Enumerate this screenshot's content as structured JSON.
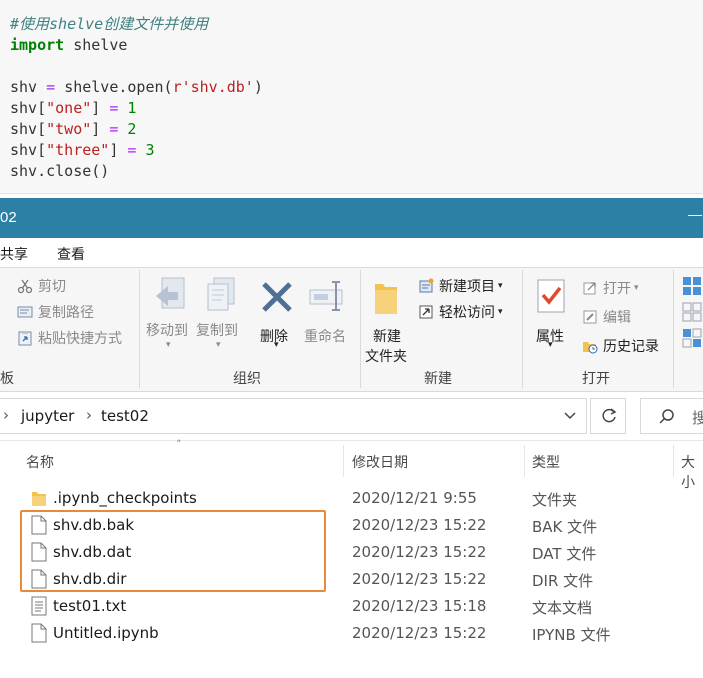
{
  "code": {
    "comment": "#使用shelve创建文件并使用",
    "import_kw": "import",
    "import_mod": " shelve",
    "line_open_a": "shv",
    "line_open_b": " = ",
    "line_open_c": "shelve.open(",
    "line_open_d": "r'shv.db'",
    "line_open_e": ")",
    "assign1_a": "shv[",
    "assign1_key": "\"one\"",
    "assign1_b": "] ",
    "assign1_eq": "=",
    "assign1_val": " 1",
    "assign2_a": "shv[",
    "assign2_key": "\"two\"",
    "assign2_b": "] ",
    "assign2_eq": "=",
    "assign2_val": " 2",
    "assign3_a": "shv[",
    "assign3_key": "\"three\"",
    "assign3_b": "] ",
    "assign3_eq": "=",
    "assign3_val": " 3",
    "close": "shv.close()"
  },
  "window": {
    "title": "02",
    "minimize": "—"
  },
  "menu": {
    "share": "共享",
    "view": "查看"
  },
  "ribbon": {
    "cut": "剪切",
    "copy_path": "复制路径",
    "paste_shortcut": "粘贴快捷方式",
    "move_to": "移动到",
    "copy_to": "复制到",
    "delete": "删除",
    "rename": "重命名",
    "new_folder_1": "新建",
    "new_folder_2": "文件夹",
    "new_item": "新建项目",
    "easy_access": "轻松访问",
    "properties": "属性",
    "open": "打开",
    "edit": "编辑",
    "history": "历史记录",
    "group_clipboard_tail": "板",
    "group_organize": "组织",
    "group_new": "新建",
    "group_open": "打开"
  },
  "address": {
    "crumbs": [
      "jupyter",
      "test02"
    ],
    "search_placeholder": "搜"
  },
  "columns": {
    "name": "名称",
    "date": "修改日期",
    "type": "类型",
    "size": "大小"
  },
  "files": [
    {
      "name": ".ipynb_checkpoints",
      "date": "2020/12/21 9:55",
      "type": "文件夹",
      "icon": "folder-icon"
    },
    {
      "name": "shv.db.bak",
      "date": "2020/12/23 15:22",
      "type": "BAK 文件",
      "icon": "file-icon"
    },
    {
      "name": "shv.db.dat",
      "date": "2020/12/23 15:22",
      "type": "DAT 文件",
      "icon": "file-icon"
    },
    {
      "name": "shv.db.dir",
      "date": "2020/12/23 15:22",
      "type": "DIR 文件",
      "icon": "file-icon"
    },
    {
      "name": "test01.txt",
      "date": "2020/12/23 15:18",
      "type": "文本文档",
      "icon": "text-file-icon"
    },
    {
      "name": "Untitled.ipynb",
      "date": "2020/12/23 15:22",
      "type": "IPYNB 文件",
      "icon": "file-icon"
    }
  ],
  "colors": {
    "titlebar": "#2c7fa5",
    "highlight": "#e88a3a"
  }
}
